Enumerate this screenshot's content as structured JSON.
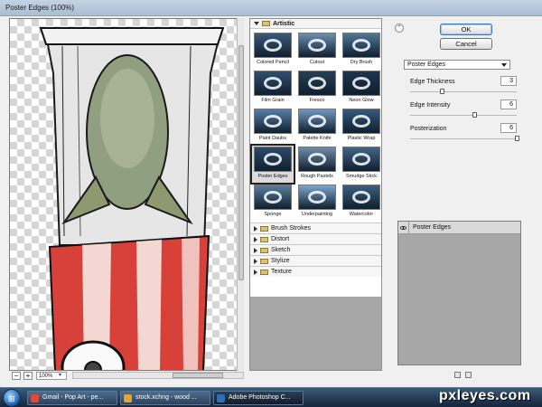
{
  "window": {
    "title": "Poster Edges (100%)"
  },
  "preview": {
    "zoom_value": "100%",
    "zoom_out": "−",
    "zoom_in": "+"
  },
  "gallery": {
    "open_category": "Artistic",
    "thumbnails": [
      {
        "label": "Colored Pencil",
        "bg": "#3a5a7a",
        "selected": false
      },
      {
        "label": "Cutout",
        "bg": "#6c8fb2",
        "selected": false
      },
      {
        "label": "Dry Brush",
        "bg": "#4d7799",
        "selected": false
      },
      {
        "label": "Film Grain",
        "bg": "#2f4f6f",
        "selected": false
      },
      {
        "label": "Fresco",
        "bg": "#263f57",
        "selected": false
      },
      {
        "label": "Neon Glow",
        "bg": "#1f3550",
        "selected": false
      },
      {
        "label": "Paint Daubs",
        "bg": "#557fa8",
        "selected": false
      },
      {
        "label": "Palette Knife",
        "bg": "#7099c0",
        "selected": false
      },
      {
        "label": "Plastic Wrap",
        "bg": "#35597d",
        "selected": false
      },
      {
        "label": "Poster Edges",
        "bg": "#2c4b6b",
        "selected": true
      },
      {
        "label": "Rough Pastels",
        "bg": "#6e8fa9",
        "selected": false
      },
      {
        "label": "Smudge Stick",
        "bg": "#416688",
        "selected": false
      },
      {
        "label": "Sponge",
        "bg": "#5a7f9f",
        "selected": false
      },
      {
        "label": "Underpainting",
        "bg": "#7aa7cf",
        "selected": false
      },
      {
        "label": "Watercolor",
        "bg": "#3b5f82",
        "selected": false
      }
    ],
    "categories": [
      "Brush Strokes",
      "Distort",
      "Sketch",
      "Stylize",
      "Texture"
    ]
  },
  "dialog": {
    "ok_label": "OK",
    "cancel_label": "Cancel",
    "filter_select": "Poster Edges",
    "params": [
      {
        "label": "Edge Thickness",
        "value": "3",
        "fraction": 0.3
      },
      {
        "label": "Edge Intensity",
        "value": "6",
        "fraction": 0.6
      },
      {
        "label": "Posterization",
        "value": "6",
        "fraction": 1.0
      }
    ]
  },
  "layers": {
    "items": [
      "Poster Edges"
    ]
  },
  "taskbar": {
    "items": [
      {
        "label": "Gmail - Pop Art - pe...",
        "icon_color": "#d94b3b",
        "active": false
      },
      {
        "label": "stock.xchng - wood ...",
        "icon_color": "#e3a23a",
        "active": false
      },
      {
        "label": "Adobe Photoshop C...",
        "icon_color": "#2f6fb2",
        "active": true
      }
    ]
  },
  "watermark": "pxleyes.com"
}
